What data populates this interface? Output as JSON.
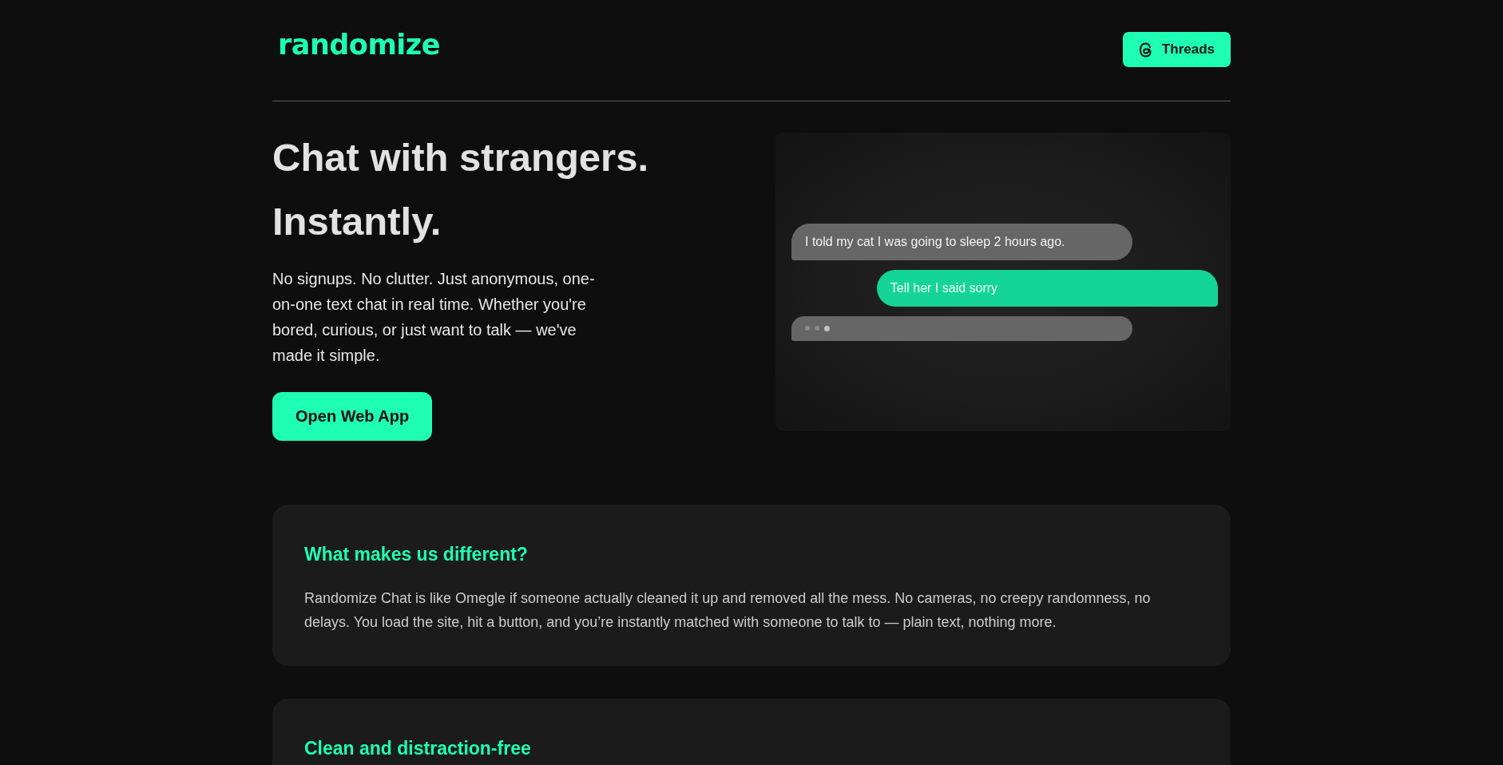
{
  "header": {
    "logo": "randomize",
    "threads_button": {
      "label": "Threads"
    }
  },
  "hero": {
    "title": "Chat with strangers. Instantly.",
    "description": "No signups. No clutter. Just anonymous, one-on-one text chat in real time. Whether you're bored, curious, or just want to talk — we've made it simple.",
    "cta": "Open Web App"
  },
  "chat_preview": {
    "messages": [
      {
        "kind": "received",
        "text": "I told my cat I was going to sleep 2 hours ago."
      },
      {
        "kind": "sent",
        "text": "Tell her I said sorry"
      },
      {
        "kind": "typing"
      }
    ]
  },
  "sections": [
    {
      "title": "What makes us different?",
      "body": "Randomize Chat is like Omegle if someone actually cleaned it up and removed all the mess. No cameras, no creepy randomness, no delays. You load the site, hit a button, and you’re instantly matched with someone to talk to — plain text, nothing more."
    },
    {
      "title": "Clean and distraction-free"
    }
  ]
}
